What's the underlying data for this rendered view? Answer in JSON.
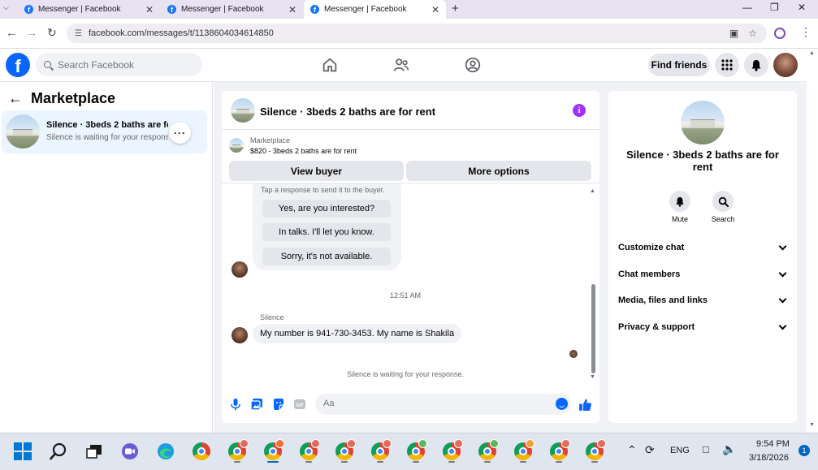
{
  "browser": {
    "tabs": [
      {
        "title": "Messenger | Facebook",
        "active": false
      },
      {
        "title": "Messenger | Facebook",
        "active": false
      },
      {
        "title": "Messenger | Facebook",
        "active": true
      }
    ],
    "url": "facebook.com/messages/t/1138604034614850"
  },
  "fb_header": {
    "search_placeholder": "Search Facebook",
    "find_friends_label": "Find friends"
  },
  "left_panel": {
    "title": "Marketplace",
    "conversations": [
      {
        "name": "Silence · 3beds 2 baths are for rent",
        "preview": "Silence is waiting for your response.",
        "more_label": "···"
      }
    ]
  },
  "chat": {
    "title": "Silence · 3beds 2 baths are for rent",
    "marketplace_label": "Marketplace",
    "listing": "$820 - 3beds 2 baths are for rent",
    "view_buyer_label": "View buyer",
    "more_options_label": "More options",
    "quick_hint": "Tap a response to send it to the buyer.",
    "quick_replies": [
      "Yes, are you interested?",
      "In talks. I'll let you know.",
      "Sorry, it's not available."
    ],
    "timestamp": "12:51 AM",
    "sender_name": "Silence",
    "message": "My number is 941-730-3453. My name is Shakila",
    "waiting_text": "Silence is waiting for your response.",
    "composer_placeholder": "Aa"
  },
  "right_panel": {
    "name": "Silence · 3beds 2 baths are for rent",
    "actions": [
      {
        "label": "Mute",
        "icon": "bell-icon"
      },
      {
        "label": "Search",
        "icon": "search-icon"
      }
    ],
    "sections": [
      "Customize chat",
      "Chat members",
      "Media, files and links",
      "Privacy & support"
    ]
  },
  "taskbar": {
    "language": "ENG",
    "time": "9:54 PM",
    "date": "3/18/2026",
    "notification_count": "1"
  },
  "colors": {
    "fb_blue": "#0866ff",
    "selected_row": "#ebf5ff",
    "info_purple": "#a033ff"
  }
}
